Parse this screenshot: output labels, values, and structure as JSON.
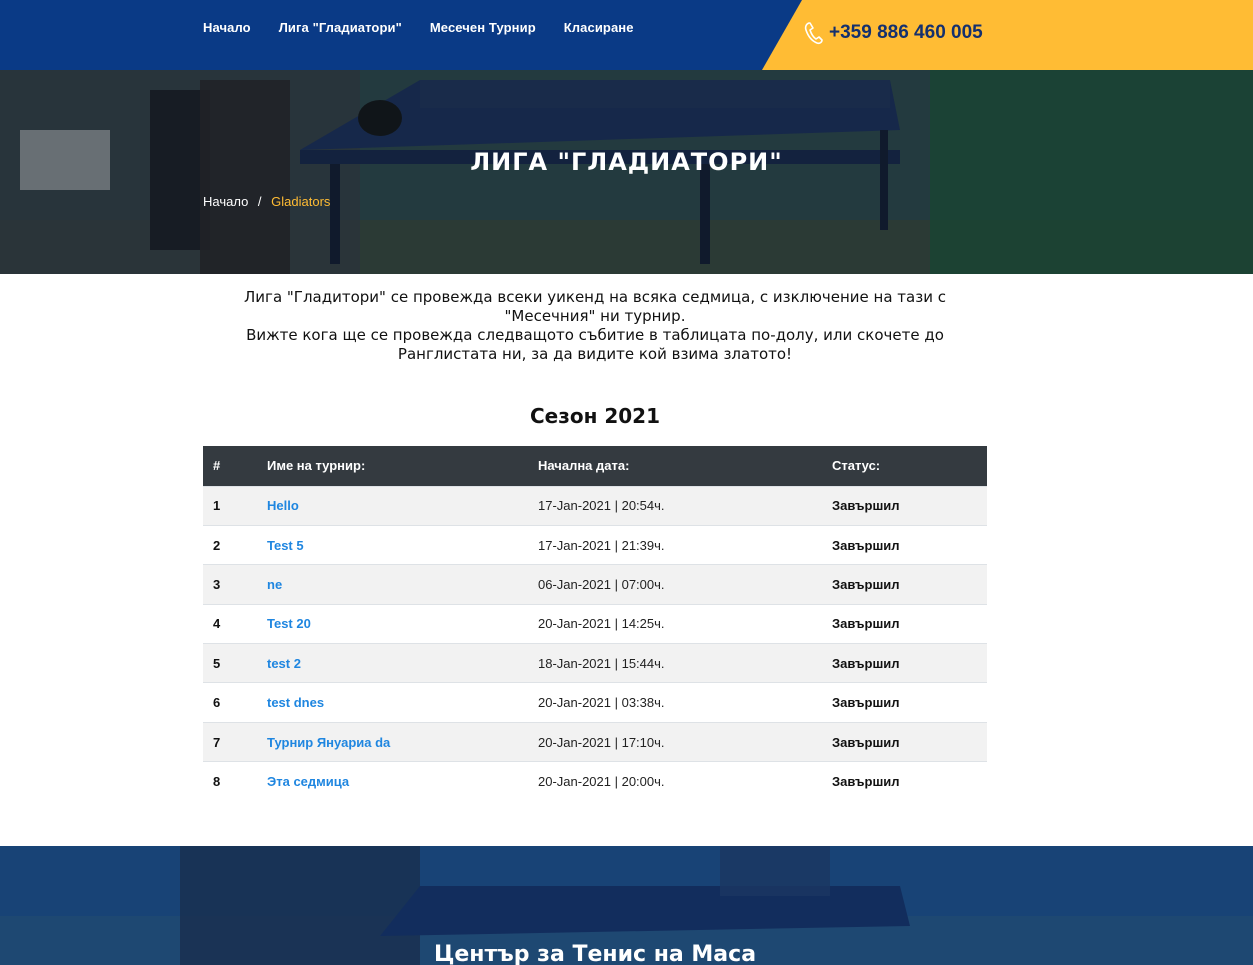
{
  "nav": {
    "items": [
      {
        "label": "Начало"
      },
      {
        "label": "Лига \"Гладиатори\""
      },
      {
        "label": "Месечен Турнир"
      },
      {
        "label": "Класиране"
      }
    ],
    "phone": "+359 886 460 005"
  },
  "hero": {
    "title": "ЛИГА \"ГЛАДИАТОРИ\"",
    "breadcrumb": {
      "home": "Начало",
      "separator": "/",
      "current": "Gladiators"
    }
  },
  "intro": {
    "line1": "Лига \"Гладитори\" се провежда всеки уикенд на всяка седмица, с изключение на тази с \"Месечния\" ни турнир.",
    "line2": "Вижте кога ще се провежда следващото събитие в таблицата по-долу, или скочете до Ранглистата ни, за да видите кой взима златото!"
  },
  "season": {
    "title": "Сезон 2021"
  },
  "table": {
    "headers": {
      "num": "#",
      "name": "Име на турнир:",
      "date": "Начална дата:",
      "status": "Статус:"
    },
    "rows": [
      {
        "num": "1",
        "name": "Hello",
        "date": "17-Jan-2021 | 20:54ч.",
        "status": "Завършил"
      },
      {
        "num": "2",
        "name": "Test 5",
        "date": "17-Jan-2021 | 21:39ч.",
        "status": "Завършил"
      },
      {
        "num": "3",
        "name": "ne",
        "date": "06-Jan-2021 | 07:00ч.",
        "status": "Завършил"
      },
      {
        "num": "4",
        "name": "Test 20",
        "date": "20-Jan-2021 | 14:25ч.",
        "status": "Завършил"
      },
      {
        "num": "5",
        "name": "test 2",
        "date": "18-Jan-2021 | 15:44ч.",
        "status": "Завършил"
      },
      {
        "num": "6",
        "name": "test dnes",
        "date": "20-Jan-2021 | 03:38ч.",
        "status": "Завършил"
      },
      {
        "num": "7",
        "name": "Турнир Януариа da",
        "date": "20-Jan-2021 | 17:10ч.",
        "status": "Завършил"
      },
      {
        "num": "8",
        "name": "Эта седмица",
        "date": "20-Jan-2021 | 20:00ч.",
        "status": "Завършил"
      }
    ]
  },
  "footer": {
    "title": "Център за Тенис на Маса"
  },
  "colors": {
    "navy": "#0a3a86",
    "accent": "#ffbc34",
    "link": "#1f86e0",
    "table_header": "#343a40"
  }
}
